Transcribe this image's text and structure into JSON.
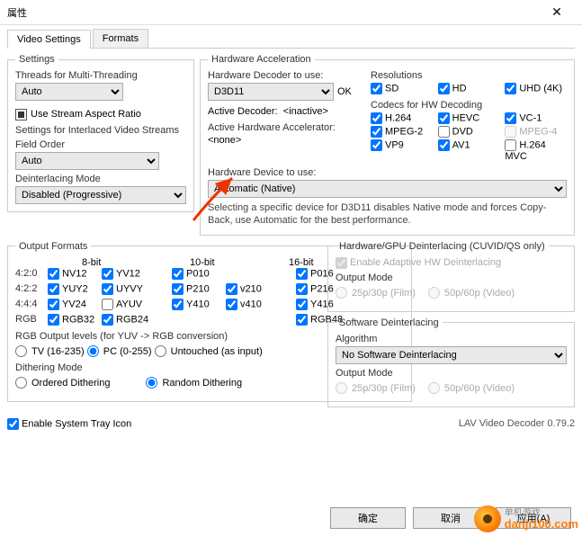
{
  "window": {
    "title": "属性"
  },
  "tabs": {
    "video": "Video Settings",
    "formats": "Formats"
  },
  "settings": {
    "legend": "Settings",
    "threads_label": "Threads for Multi-Threading",
    "threads_value": "Auto",
    "use_stream_aspect": "Use Stream Aspect Ratio",
    "interlaced_label": "Settings for Interlaced Video Streams",
    "field_order_label": "Field Order",
    "field_order_value": "Auto",
    "deint_mode_label": "Deinterlacing Mode",
    "deint_mode_value": "Disabled (Progressive)"
  },
  "hwaccel": {
    "legend": "Hardware Acceleration",
    "decoder_label": "Hardware Decoder to use:",
    "decoder_value": "D3D11",
    "ok": "OK",
    "active_decoder_label": "Active Decoder:",
    "active_decoder_value": "<inactive>",
    "active_hw_label": "Active Hardware Accelerator:",
    "active_hw_value": "<none>",
    "device_label": "Hardware Device to use:",
    "device_value": "Automatic (Native)",
    "note": "Selecting a specific device for D3D11 disables Native mode and forces Copy-Back, use Automatic for the best performance.",
    "res_legend": "Resolutions",
    "res": {
      "sd": "SD",
      "hd": "HD",
      "uhd": "UHD (4K)"
    },
    "codec_legend": "Codecs for HW Decoding",
    "codec": {
      "h264": "H.264",
      "hevc": "HEVC",
      "vc1": "VC-1",
      "mpeg2": "MPEG-2",
      "dvd": "DVD",
      "mpeg4": "MPEG-4",
      "vp9": "VP9",
      "av1": "AV1",
      "h264mvc": "H.264 MVC"
    }
  },
  "formats": {
    "legend": "Output Formats",
    "bits": {
      "b8": "8-bit",
      "b10": "10-bit",
      "b16": "16-bit"
    },
    "rows": {
      "r420": "4:2:0",
      "r422": "4:2:2",
      "r444": "4:4:4",
      "rgb": "RGB"
    },
    "c": {
      "nv12": "NV12",
      "yv12": "YV12",
      "p010": "P010",
      "p016": "P016",
      "yuy2": "YUY2",
      "uyvy": "UYVY",
      "p210": "P210",
      "v210": "v210",
      "p216": "P216",
      "yv24": "YV24",
      "ayuv": "AYUV",
      "y410": "Y410",
      "v410": "v410",
      "y416": "Y416",
      "rgb32": "RGB32",
      "rgb24": "RGB24",
      "rgb48": "RGB48"
    },
    "rgb_levels_label": "RGB Output levels (for YUV -> RGB conversion)",
    "rgb_levels": {
      "tv": "TV (16-235)",
      "pc": "PC (0-255)",
      "untouched": "Untouched (as input)"
    },
    "dither_label": "Dithering Mode",
    "dither": {
      "ordered": "Ordered Dithering",
      "random": "Random Dithering"
    }
  },
  "gpudeint": {
    "legend": "Hardware/GPU Deinterlacing (CUVID/QS only)",
    "enable": "Enable Adaptive HW Deinterlacing",
    "output_mode": "Output Mode",
    "m25": "25p/30p (Film)",
    "m50": "50p/60p (Video)"
  },
  "swdeint": {
    "legend": "Software Deinterlacing",
    "algo_label": "Algorithm",
    "algo_value": "No Software Deinterlacing",
    "output_mode": "Output Mode",
    "m25": "25p/30p (Film)",
    "m50": "50p/60p (Video)"
  },
  "tray": {
    "label": "Enable System Tray Icon",
    "version": "LAV Video Decoder 0.79.2"
  },
  "buttons": {
    "ok": "确定",
    "cancel": "取消",
    "apply": "应用(A)"
  },
  "watermark": {
    "line1": "单机游戏",
    "line2": "danji100.com"
  }
}
